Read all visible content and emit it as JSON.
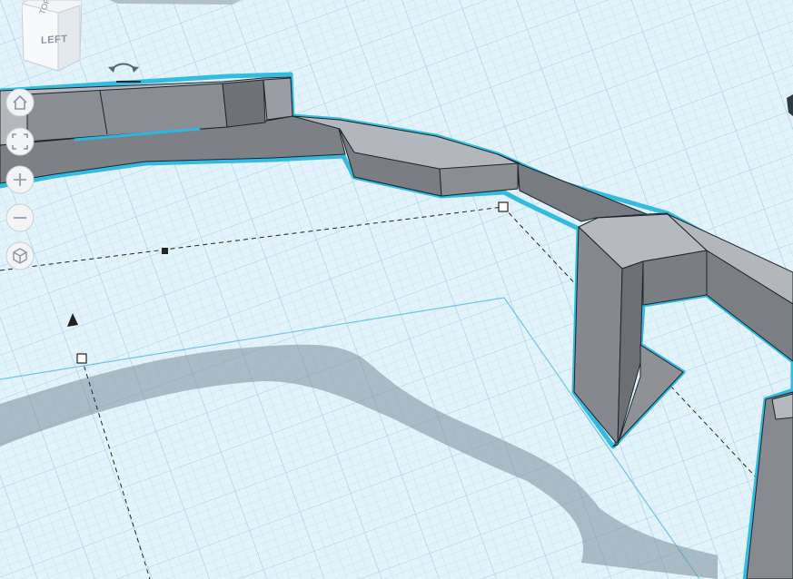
{
  "view_cube": {
    "face_label": "LEFT",
    "top_label": "TOP"
  },
  "nav_controls": [
    {
      "name": "home-view-button",
      "icon": "home-icon"
    },
    {
      "name": "fit-view-button",
      "icon": "fit-view-icon"
    },
    {
      "name": "zoom-in-button",
      "icon": "plus-icon"
    },
    {
      "name": "zoom-out-button",
      "icon": "minus-icon"
    },
    {
      "name": "perspective-button",
      "icon": "cube-perspective-icon"
    }
  ],
  "colors": {
    "grid_background": "#dff1fa",
    "grid_line": "#b9dcec",
    "selection_outline": "#19b5dc",
    "part_top": "#b3b6ba",
    "part_side": "#7b7f84",
    "shadow": "#7e93a0"
  }
}
